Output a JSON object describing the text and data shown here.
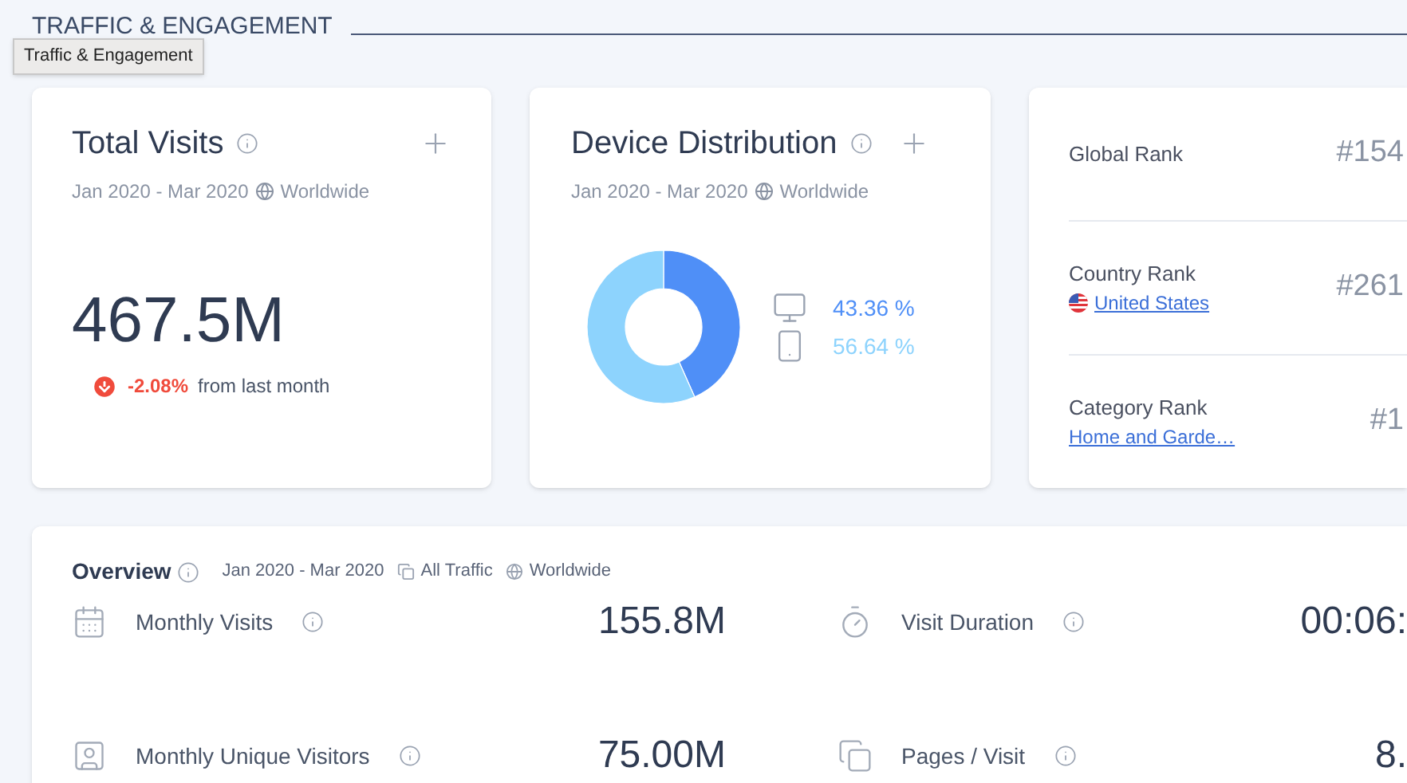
{
  "section": {
    "title": "TRAFFIC & ENGAGEMENT",
    "tooltip": "Traffic & Engagement"
  },
  "total_visits": {
    "title": "Total Visits",
    "date_range": "Jan 2020 - Mar 2020",
    "region": "Worldwide",
    "value": "467.5M",
    "change": {
      "value": "-2.08%",
      "negative": true,
      "label": "from last month"
    }
  },
  "device_distribution": {
    "title": "Device Distribution",
    "date_range": "Jan 2020 - Mar 2020",
    "region": "Worldwide",
    "legend": [
      {
        "kind": "desktop",
        "value": "43.36 %",
        "color": "#4f8ff7"
      },
      {
        "kind": "mobile",
        "value": "56.64 %",
        "color": "#8dd3fd"
      }
    ],
    "chart_data": {
      "type": "donut",
      "values": [
        43.36,
        56.64
      ]
    }
  },
  "ranks": [
    {
      "label": "Global Rank",
      "value": "#154"
    },
    {
      "label": "Country Rank",
      "link": "United States",
      "flag": true,
      "value": "#261"
    },
    {
      "label": "Category Rank",
      "link": "Home and Garde…",
      "flag": false,
      "value": "#1"
    }
  ],
  "overview": {
    "title": "Overview",
    "date_range": "Jan 2020 - Mar 2020",
    "traffic": "All Traffic",
    "region": "Worldwide",
    "metrics": [
      {
        "kind": "calendar",
        "label": "Monthly Visits",
        "value": "155.8M"
      },
      {
        "kind": "timer",
        "label": "Visit Duration",
        "value": "00:06:"
      },
      {
        "kind": "person",
        "label": "Monthly Unique Visitors",
        "value": "75.00M"
      },
      {
        "kind": "pages",
        "label": "Pages / Visit",
        "value": "8."
      }
    ]
  }
}
